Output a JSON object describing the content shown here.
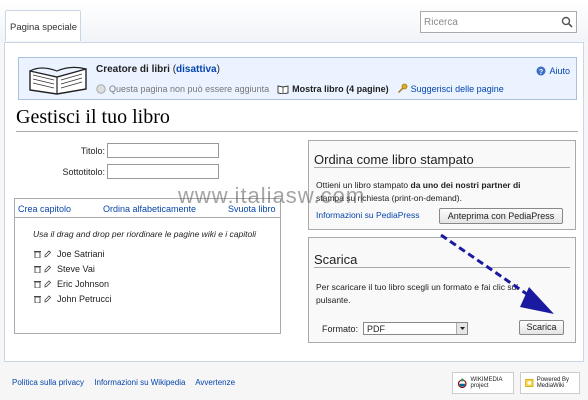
{
  "header": {
    "tab_label": "Pagina speciale",
    "search_placeholder": "Ricerca"
  },
  "creator": {
    "title": "Creatore di libri",
    "disable_link": "disattiva",
    "cannot_add": "Questa pagina non può essere aggiunta",
    "show_book": "Mostra libro (4 pagine)",
    "suggest": "Suggerisci delle pagine",
    "help": "Aiuto"
  },
  "page_title": "Gestisci il tuo libro",
  "form": {
    "title_label": "Titolo:",
    "subtitle_label": "Sottotitolo:",
    "title_value": "",
    "subtitle_value": ""
  },
  "chapters": {
    "create_chapter": "Crea capitolo",
    "sort_alpha": "Ordina alfabeticamente",
    "clear_book": "Svuota libro",
    "hint": "Usa il drag and drop per riordinare le pagine wiki e i capitoli",
    "items": [
      "Joe Satriani",
      "Steve Vai",
      "Eric Johnson",
      "John Petrucci"
    ]
  },
  "order_panel": {
    "heading": "Ordina come libro stampato",
    "text_line1_a": "Ottieni un libro stampato ",
    "text_line1_b": "da uno dei nostri partner di",
    "text_line2": "stampa su richiesta (print-on-demand).",
    "info_link": "Informazioni su PediaPress",
    "preview_button": "Anteprima con PediaPress"
  },
  "download_panel": {
    "heading": "Scarica",
    "text_line1": "Per scaricare il tuo libro scegli un formato e fai clic sul",
    "text_line2": "pulsante.",
    "format_label": "Formato:",
    "format_value": "PDF",
    "download_button": "Scarica"
  },
  "watermark": "www.italiasw.com",
  "footer": {
    "links": [
      "Politica sulla privacy",
      "Informazioni su Wikipedia",
      "Avvertenze"
    ],
    "wikimedia_badge": "WIKIMEDIA project",
    "mediawiki_badge": "Powered By MediaWiki"
  },
  "colors": {
    "link": "#0645ad",
    "creator_bg": "#eaf3ff",
    "annotation_arrow": "#1a1aa0"
  }
}
